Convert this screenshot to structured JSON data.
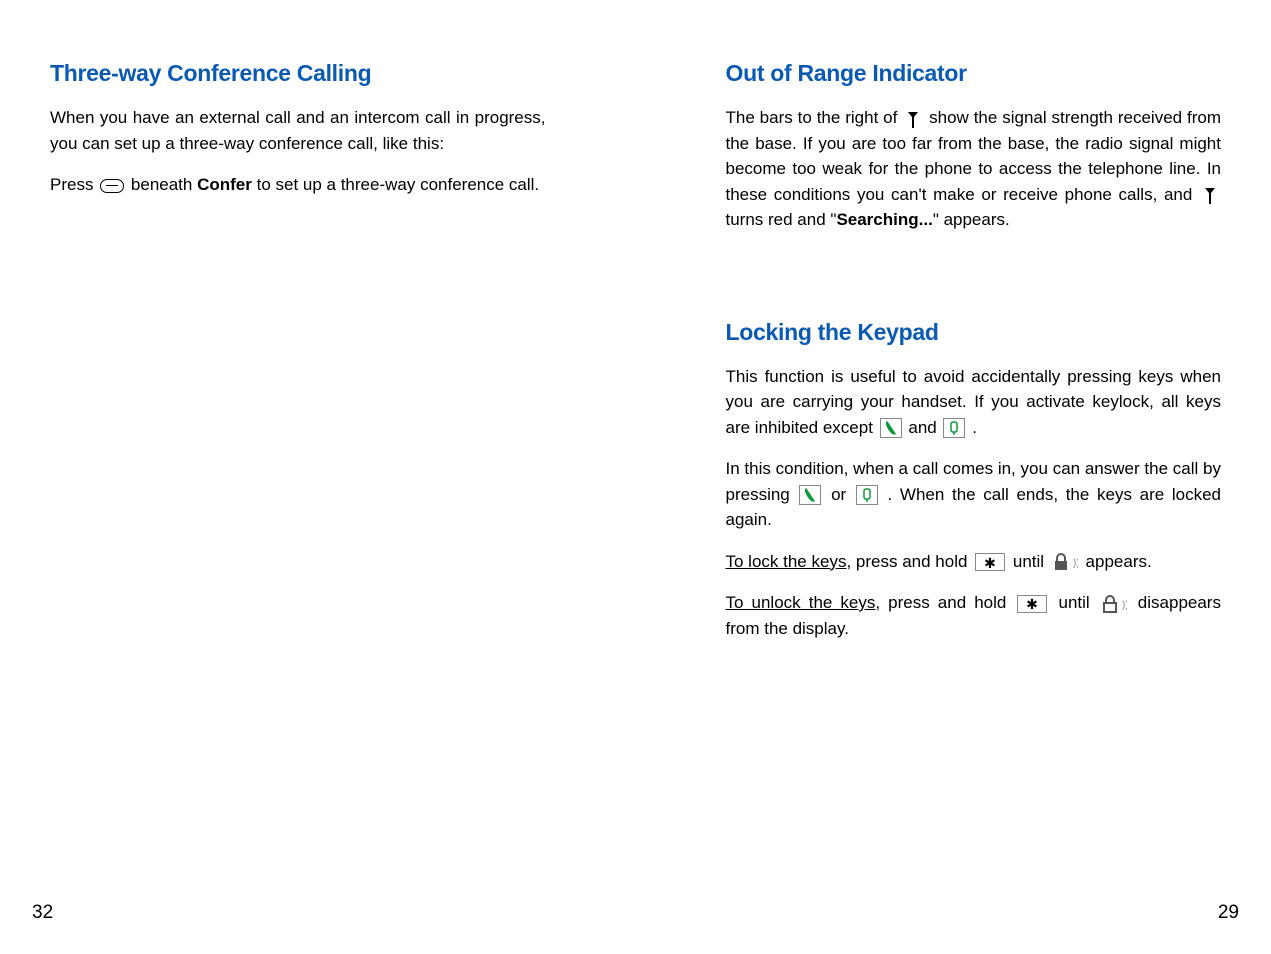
{
  "left": {
    "heading": "Three-way Conference Calling",
    "p1": "When you have an external call and an intercom call in progress, you can set up a three-way conference call, like this:",
    "p2a": "Press ",
    "p2b": " beneath ",
    "confer": "Confer",
    "p2c": " to set up a three-way conference call.",
    "pageNumber": "32"
  },
  "right": {
    "section1": {
      "heading": "Out of Range Indicator",
      "p1a": "The bars to the right of ",
      "p1b": " show the signal strength received from the base. If you are too far from the base, the radio signal might become too weak for the phone to access the telephone line. In these conditions you can't make or receive phone calls, and ",
      "p1c": " turns red and \"",
      "searching": "Searching...",
      "p1d": "\" appears."
    },
    "section2": {
      "heading": "Locking the Keypad",
      "p1a": "This function is useful to avoid accidentally pressing keys when you are carrying your handset. If you activate keylock, all keys are inhibited except ",
      "and": " and ",
      "p1b": " .",
      "p2a": "In this condition, when a call comes in, you can answer the call by pressing ",
      "or": " or ",
      "p2b": ". When the call ends, the keys are locked again.",
      "p3label": "To lock the keys",
      "p3a": ", press and hold ",
      "p3b": " until ",
      "p3c": " appears.",
      "p4label": "To unlock the keys",
      "p4a": ", press and hold ",
      "p4b": " until ",
      "p4c": " disappears from the display."
    },
    "pageNumber": "29"
  }
}
